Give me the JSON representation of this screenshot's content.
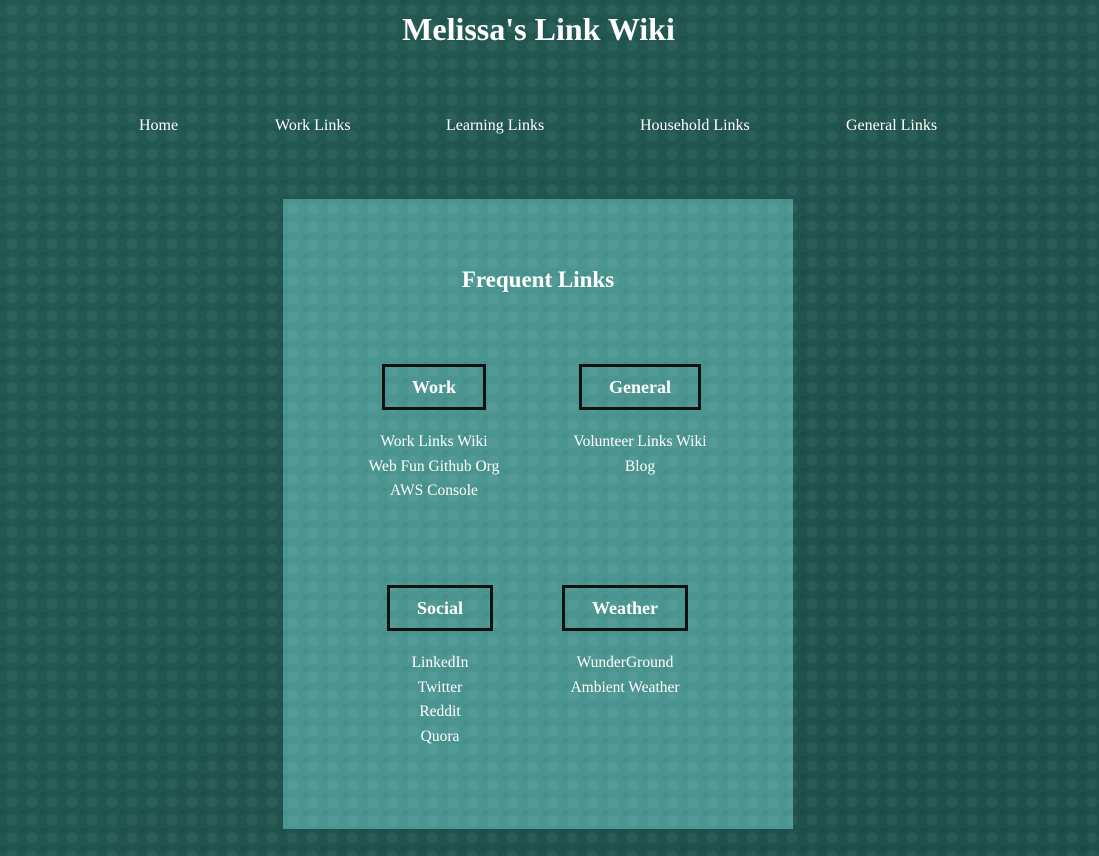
{
  "site": {
    "title": "Melissa's Link Wiki"
  },
  "nav": {
    "items": [
      {
        "label": "Home"
      },
      {
        "label": "Work Links"
      },
      {
        "label": "Learning Links"
      },
      {
        "label": "Household Links"
      },
      {
        "label": "General Links"
      }
    ]
  },
  "panel": {
    "title": "Frequent Links",
    "groups": [
      {
        "heading": "Work",
        "links": [
          "Work Links Wiki",
          "Web Fun Github Org",
          "AWS Console"
        ]
      },
      {
        "heading": "General",
        "links": [
          "Volunteer Links Wiki",
          "Blog"
        ]
      },
      {
        "heading": "Social",
        "links": [
          "LinkedIn",
          "Twitter",
          "Reddit",
          "Quora"
        ]
      },
      {
        "heading": "Weather",
        "links": [
          "WunderGround",
          "Ambient Weather"
        ]
      }
    ]
  },
  "colors": {
    "background": "#225650",
    "panel": "#4b9590",
    "text": "#ffffff",
    "heading_border": "#111111"
  }
}
